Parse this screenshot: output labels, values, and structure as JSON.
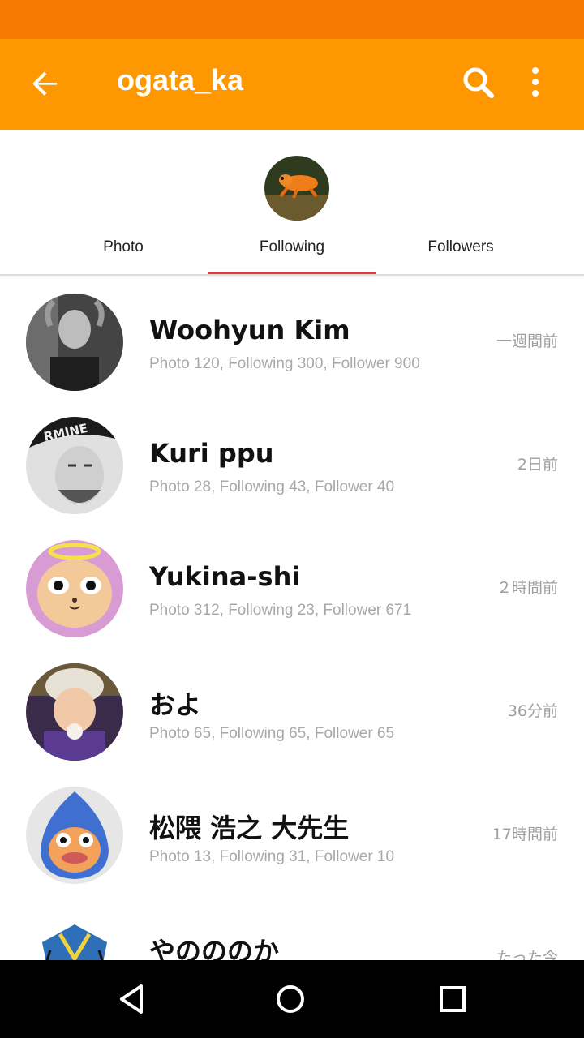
{
  "app": {
    "title": "ogata_ka",
    "icons": {
      "back": "arrow-back-icon",
      "search": "search-icon",
      "more": "more-vert-icon"
    },
    "colors": {
      "appbar": "#ff9800",
      "statusbar": "#f57c00",
      "tab_indicator": "#e53935"
    }
  },
  "tabs": [
    {
      "label": "Photo",
      "selected": false
    },
    {
      "label": "Following",
      "selected": true
    },
    {
      "label": "Followers",
      "selected": false
    }
  ],
  "users": [
    {
      "name": "Woohyun Kim",
      "stats": "Photo 120,  Following 300, Follower 900",
      "time": "一週間前"
    },
    {
      "name": "Kuri ppu",
      "stats": "Photo 28,  Following 43, Follower 40",
      "time": "2日前"
    },
    {
      "name": "Yukina-shi",
      "stats": "Photo 312,  Following 23, Follower 671",
      "time": "２時間前"
    },
    {
      "name": "およ",
      "stats": "Photo 65, Following 65, Follower 65",
      "time": "36分前"
    },
    {
      "name": "松隈 浩之 大先生",
      "stats": "Photo 13,  Following 31, Follower 10",
      "time": "17時間前"
    },
    {
      "name": "やのののか",
      "stats": "",
      "time": "たった今"
    }
  ],
  "navbar": {
    "icons": [
      "nav-back-icon",
      "nav-home-icon",
      "nav-recents-icon"
    ]
  }
}
